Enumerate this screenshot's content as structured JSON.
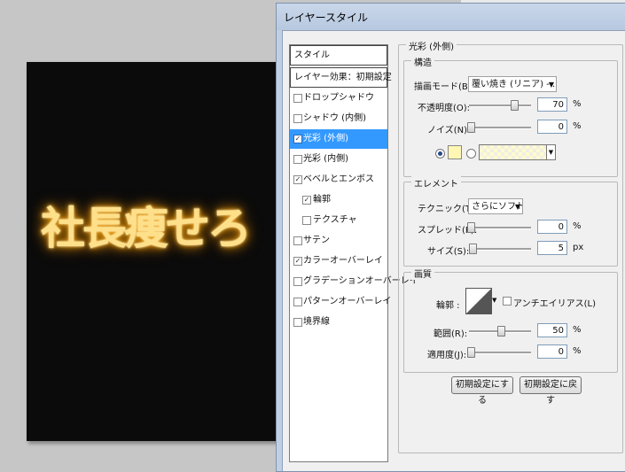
{
  "canvas": {
    "text": "社長痩せろ"
  },
  "dialog": {
    "title": "レイヤースタイル",
    "list": {
      "items": [
        {
          "label": "スタイル",
          "type": "header",
          "checkbox": null
        },
        {
          "label": "レイヤー効果：初期設定",
          "type": "header",
          "checkbox": null
        },
        {
          "label": "ドロップシャドウ",
          "checked": false
        },
        {
          "label": "シャドウ (内側)",
          "checked": false
        },
        {
          "label": "光彩 (外側)",
          "checked": true,
          "selected": true
        },
        {
          "label": "光彩 (内側)",
          "checked": false
        },
        {
          "label": "ベベルとエンボス",
          "checked": true
        },
        {
          "label": "輪郭",
          "checked": true,
          "indent": true
        },
        {
          "label": "テクスチャ",
          "checked": false,
          "indent": true
        },
        {
          "label": "サテン",
          "checked": false
        },
        {
          "label": "カラーオーバーレイ",
          "checked": true
        },
        {
          "label": "グラデーションオーバーレイ",
          "checked": false
        },
        {
          "label": "パターンオーバーレイ",
          "checked": false
        },
        {
          "label": "境界線",
          "checked": false
        }
      ]
    },
    "panel_title": "光彩 (外側)",
    "structure": {
      "title": "構造",
      "blend_mode_label": "描画モード(B) :",
      "blend_mode_value": "覆い焼き (リニア) - ...",
      "opacity_label": "不透明度(O):",
      "opacity_value": "70",
      "opacity_unit": "%",
      "noise_label": "ノイズ(N):",
      "noise_value": "0",
      "noise_unit": "%",
      "color_swatch": "#fff7b3"
    },
    "elements": {
      "title": "エレメント",
      "technique_label": "テクニック(T):",
      "technique_value": "さらにソフトに",
      "spread_label": "スプレッド(P):",
      "spread_value": "0",
      "spread_unit": "%",
      "size_label": "サイズ(S):",
      "size_value": "5",
      "size_unit": "px"
    },
    "quality": {
      "title": "画質",
      "contour_label": "輪郭 :",
      "antialias_label": "アンチエイリアス(L)",
      "range_label": "範囲(R):",
      "range_value": "50",
      "range_unit": "%",
      "jitter_label": "適用度(J):",
      "jitter_value": "0",
      "jitter_unit": "%"
    },
    "buttons": {
      "make_default": "初期設定にする",
      "reset_default": "初期設定に戻す"
    }
  }
}
